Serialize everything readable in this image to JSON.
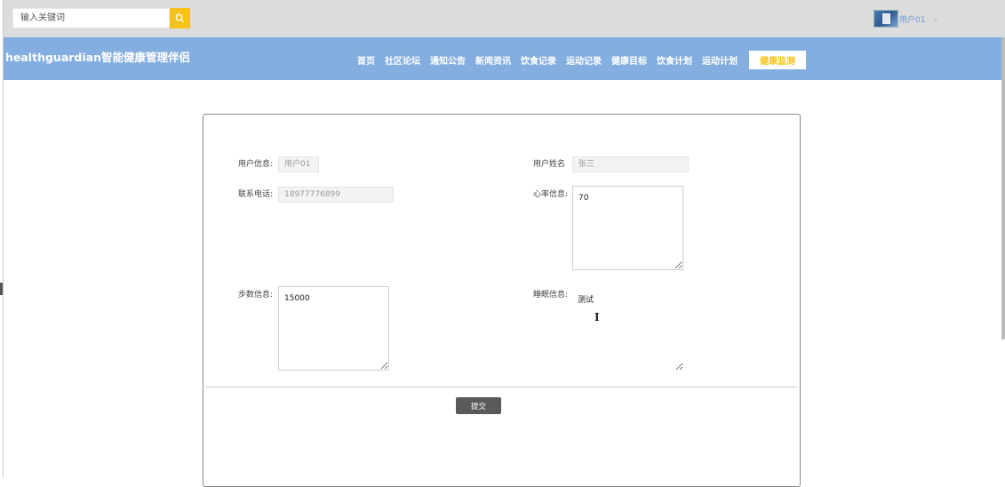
{
  "topbar": {
    "search_placeholder": "输入关键词",
    "user_name": "用户01",
    "caret": "⌄"
  },
  "navbar": {
    "brand": "healthguardian智能健康管理伴侣",
    "items": [
      "首页",
      "社区论坛",
      "通知公告",
      "新闻资讯",
      "饮食记录",
      "运动记录",
      "健康目标",
      "饮食计划",
      "运动计划"
    ],
    "active_item": "健康监测",
    "bg_color": "#84aedf",
    "accent_color": "#f5c21b"
  },
  "form": {
    "user_info_label": "用户信息:",
    "user_info_value": "用户01",
    "user_realname_label": "用户姓名",
    "user_realname_value": "张三",
    "phone_label": "联系电话:",
    "phone_value": "18977776899",
    "heart_label": "心率信息:",
    "heart_value": "70",
    "steps_label": "步数信息:",
    "steps_value": "15000",
    "sleep_label": "睡眠信息:",
    "sleep_value": "测试",
    "submit_label": "提交"
  }
}
